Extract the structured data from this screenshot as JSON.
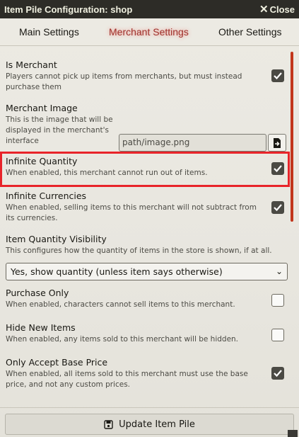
{
  "window": {
    "title": "Item Pile Configuration: shop",
    "close_label": "Close"
  },
  "tabs": [
    {
      "label": "Main Settings"
    },
    {
      "label": "Merchant Settings",
      "active": true
    },
    {
      "label": "Other Settings"
    }
  ],
  "settings": {
    "is_merchant": {
      "label": "Is Merchant",
      "desc": "Players cannot pick up items from merchants, but must instead purchase them",
      "checked": true
    },
    "merchant_image": {
      "label": "Merchant Image",
      "desc": "This is the image that will be displayed in the merchant's interface",
      "value": "path/image.png"
    },
    "infinite_quantity": {
      "label": "Infinite Quantity",
      "desc": "When enabled, this merchant cannot run out of items.",
      "checked": true
    },
    "infinite_currencies": {
      "label": "Infinite Currencies",
      "desc": "When enabled, selling items to this merchant will not subtract from its currencies.",
      "checked": true
    },
    "quantity_visibility": {
      "label": "Item Quantity Visibility",
      "desc": "This configures how the quantity of items in the store is shown, if at all.",
      "selected": "Yes, show quantity (unless item says otherwise)"
    },
    "purchase_only": {
      "label": "Purchase Only",
      "desc": "When enabled, characters cannot sell items to this merchant.",
      "checked": false
    },
    "hide_new_items": {
      "label": "Hide New Items",
      "desc": "When enabled, any items sold to this merchant will be hidden.",
      "checked": false
    },
    "only_base_price": {
      "label": "Only Accept Base Price",
      "desc": "When enabled, all items sold to this merchant must use the base price, and not any custom prices.",
      "checked": true
    }
  },
  "footer": {
    "update_label": "Update Item Pile"
  },
  "colors": {
    "accent": "#c2361c",
    "highlight": "#e8242a",
    "titlebar": "#2d2c27"
  },
  "icons": [
    "close-icon",
    "checkmark-icon",
    "file-picker-icon",
    "chevron-down-icon",
    "save-icon"
  ]
}
